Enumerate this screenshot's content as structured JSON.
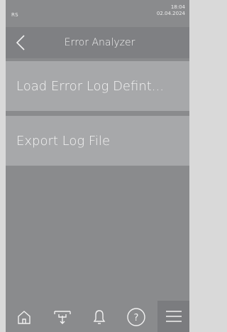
{
  "status": {
    "left_label": "RS",
    "time": "18:04",
    "date": "02.04.2024"
  },
  "header": {
    "title": "Error Analyzer",
    "back_icon": "chevron-left-icon"
  },
  "menu": {
    "items": [
      {
        "label": "Load Error Log Defint..."
      },
      {
        "label": "Export Log File"
      }
    ]
  },
  "footer": {
    "icons": [
      "home-icon",
      "download-tray-icon",
      "bell-icon",
      "help-icon",
      "menu-icon"
    ]
  },
  "colors": {
    "background": "#8a8b8d",
    "header": "#7f8083",
    "item": "#a7a8aa",
    "text": "#f4f4f4"
  }
}
